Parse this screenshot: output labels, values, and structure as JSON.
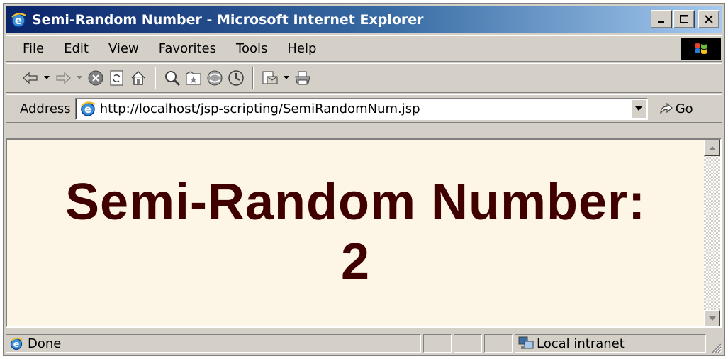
{
  "window": {
    "title": "Semi-Random Number - Microsoft Internet Explorer",
    "icon": "ie-icon",
    "controls": [
      "minimize-icon",
      "maximize-icon",
      "close-icon"
    ]
  },
  "menu": {
    "items": [
      "File",
      "Edit",
      "View",
      "Favorites",
      "Tools",
      "Help"
    ]
  },
  "toolbar": {
    "buttons": [
      "back-icon",
      "forward-icon",
      "stop-icon",
      "refresh-icon",
      "home-icon",
      "search-icon",
      "favorites-icon",
      "media-icon",
      "history-icon",
      "mail-icon",
      "print-icon"
    ]
  },
  "address": {
    "label": "Address",
    "url": "http://localhost/jsp-scripting/SemiRandomNum.jsp",
    "go_label": "Go"
  },
  "page": {
    "heading": "Semi-Random Number:",
    "number": "2",
    "background": "#fdf5e6",
    "heading_color": "#400000"
  },
  "status": {
    "text": "Done",
    "zone": "Local intranet"
  }
}
